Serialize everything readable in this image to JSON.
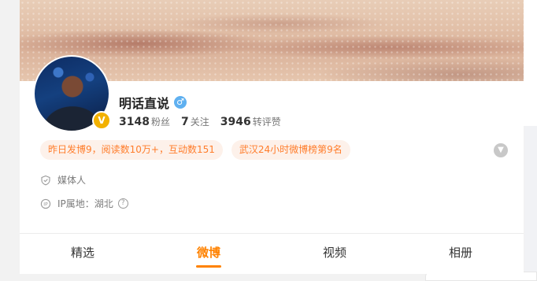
{
  "profile": {
    "name": "明话直说",
    "gender_icon": "♂",
    "verified_badge": "V",
    "stats": [
      {
        "num": "3148",
        "label": "粉丝"
      },
      {
        "num": "7",
        "label": "关注"
      },
      {
        "num": "3946",
        "label": "转评赞"
      }
    ],
    "highlights": [
      "昨日发博9，阅读数10万+，互动数151",
      "武汉24小时微博榜第9名"
    ],
    "info": {
      "category": "媒体人",
      "ip_location": "IP属地：湖北"
    }
  },
  "tabs": [
    {
      "label": "精选",
      "active": false
    },
    {
      "label": "微博",
      "active": true
    },
    {
      "label": "视频",
      "active": false
    },
    {
      "label": "相册",
      "active": false
    }
  ],
  "colors": {
    "accent": "#ff8200",
    "highlight_text": "#ff7d2b",
    "highlight_bg": "#fdf1ea",
    "verified": "#f2b100",
    "gender_male": "#5fb0f0"
  },
  "icons": [
    "expand-chevron-icon",
    "shield-icon",
    "ip-icon",
    "question-icon"
  ]
}
